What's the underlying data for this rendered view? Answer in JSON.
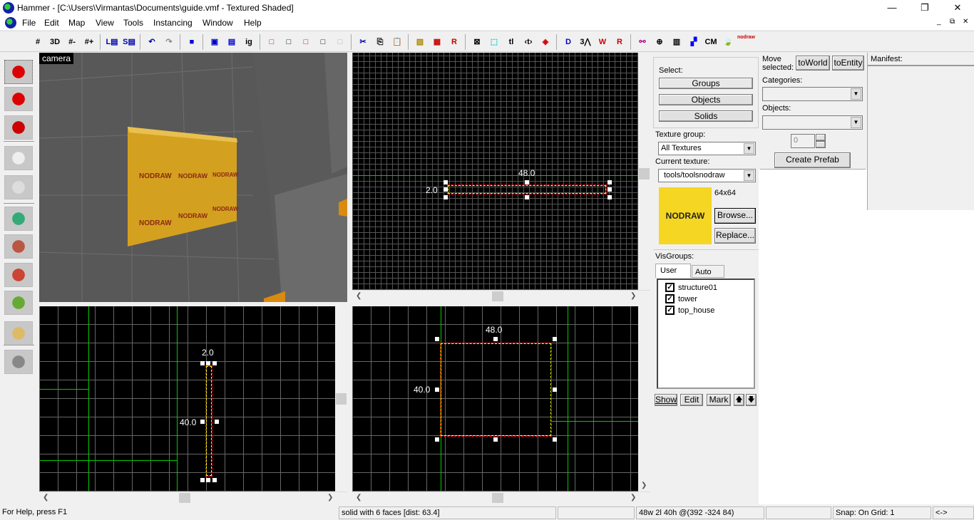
{
  "window": {
    "title": "Hammer - [C:\\Users\\Virmantas\\Documents\\guide.vmf - Textured Shaded]",
    "minimize": "—",
    "maximize": "❐",
    "close": "✕"
  },
  "menu": [
    "File",
    "Edit",
    "Map",
    "View",
    "Tools",
    "Instancing",
    "Window",
    "Help"
  ],
  "mdi_controls": [
    "_",
    "⧉",
    "✕"
  ],
  "toolbar": {
    "icons": [
      {
        "name": "grid-toggle-icon",
        "g": "#"
      },
      {
        "name": "3d-grid-icon",
        "g": "3D"
      },
      {
        "name": "grid-smaller-icon",
        "g": "#-"
      },
      {
        "name": "grid-larger-icon",
        "g": "#+"
      },
      {
        "name": "load-window-state-icon",
        "g": "L▤"
      },
      {
        "name": "save-window-state-icon",
        "g": "S▤"
      },
      {
        "name": "undo-icon",
        "g": "↶"
      },
      {
        "name": "redo-icon",
        "g": "↷"
      },
      {
        "name": "carve-icon",
        "g": "■"
      },
      {
        "name": "group-icon",
        "g": "▣"
      },
      {
        "name": "ungroup-icon",
        "g": "▤"
      },
      {
        "name": "ignore-grouping-icon",
        "g": "ig"
      },
      {
        "name": "hide-selected-icon",
        "g": "□"
      },
      {
        "name": "hide-unselected-icon",
        "g": "□"
      },
      {
        "name": "show-hidden-icon",
        "g": "□"
      },
      {
        "name": "texture-lock-icon",
        "g": "□"
      },
      {
        "name": "texture-scale-lock-icon",
        "g": "□"
      },
      {
        "name": "cut-icon",
        "g": "✂"
      },
      {
        "name": "copy-icon",
        "g": "⎘"
      },
      {
        "name": "paste-icon",
        "g": "📋"
      },
      {
        "name": "toggle-cordon-icon",
        "g": "▨"
      },
      {
        "name": "edit-cordon-icon",
        "g": "▦"
      },
      {
        "name": "radius-culling-icon",
        "g": "R"
      },
      {
        "name": "select-box-icon",
        "g": "⊠"
      },
      {
        "name": "select-by-handles-icon",
        "g": "⬚"
      },
      {
        "name": "text-lock-icon",
        "g": "tl"
      },
      {
        "name": "texture-alignment-icon",
        "g": "‹t›"
      },
      {
        "name": "displacement-icon",
        "g": "◈"
      },
      {
        "name": "2d-3d-wireframe-icon",
        "g": "D"
      },
      {
        "name": "3d-shaded-icon",
        "g": "3⋀"
      },
      {
        "name": "wireframe-icon",
        "g": "W"
      },
      {
        "name": "render-icon",
        "g": "R"
      },
      {
        "name": "models-icon",
        "g": "⚯"
      },
      {
        "name": "sphere-icon",
        "g": "⊕"
      },
      {
        "name": "lightmap-icon",
        "g": "▥"
      },
      {
        "name": "dither-icon",
        "g": "▞"
      },
      {
        "name": "cubemap-icon",
        "g": "CM"
      },
      {
        "name": "leaf-icon",
        "g": "🍃"
      },
      {
        "name": "nodraw-icon",
        "g": "nodraw"
      }
    ]
  },
  "left_tools": [
    "selection-tool-icon",
    "magnify-tool-icon",
    "camera-tool-icon",
    "entity-tool-icon",
    "block-tool-icon",
    "texture-application-icon",
    "apply-texture-icon",
    "decal-icon",
    "overlay-icon",
    "clipping-tool-icon",
    "vertex-tool-icon"
  ],
  "viewports": {
    "camera_label": "camera",
    "top": {
      "width_label": "48.0",
      "height_label": "2.0"
    },
    "side": {
      "width_label": "2.0",
      "height_label": "40.0"
    },
    "front": {
      "width_label": "48.0",
      "height_label": "40.0"
    },
    "texture_text": "NODRAW"
  },
  "select_panel": {
    "label": "Select:",
    "groups": "Groups",
    "objects": "Objects",
    "solids": "Solids"
  },
  "texture_panel": {
    "group_label": "Texture group:",
    "group_value": "All Textures",
    "current_label": "Current texture:",
    "current_value": "tools/toolsnodraw",
    "preview_text": "NODRAW",
    "size": "64x64",
    "browse": "Browse...",
    "replace": "Replace...",
    "preview_color": "#f5d623"
  },
  "visgroups": {
    "label": "VisGroups:",
    "tabs": [
      "User",
      "Auto"
    ],
    "items": [
      {
        "name": "structure01",
        "checked": true
      },
      {
        "name": "tower",
        "checked": true
      },
      {
        "name": "top_house",
        "checked": true
      }
    ],
    "show": "Show",
    "edit": "Edit",
    "mark": "Mark",
    "up": "🡅",
    "down": "🡇"
  },
  "prefab_panel": {
    "move_label": "Move selected:",
    "to_world": "toWorld",
    "to_entity": "toEntity",
    "categories_label": "Categories:",
    "objects_label": "Objects:",
    "count": "0",
    "create": "Create Prefab"
  },
  "manifest": {
    "label": "Manifest:"
  },
  "status": {
    "help": "For Help, press F1",
    "selection": "solid with 6 faces  [dist: 63.4]",
    "size": "48w 2l 40h @(392 -324 84)",
    "snap": "Snap: On Grid: 1",
    "arrows": "<->"
  }
}
